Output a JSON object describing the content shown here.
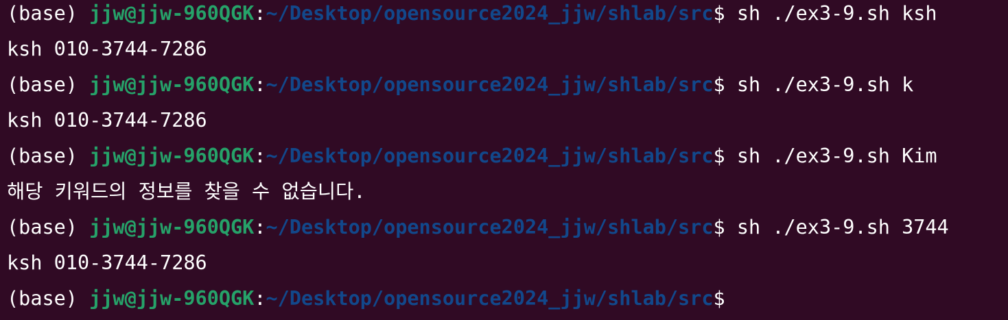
{
  "terminal": {
    "colors": {
      "background": "#300a24",
      "text": "#ffffff",
      "user_host": "#26a269",
      "path": "#12488b"
    },
    "lines": [
      {
        "type": "prompt",
        "env": "(base) ",
        "user_host": "jjw@jjw-960QGK",
        "colon": ":",
        "path": "~/Desktop/opensource2024_jjw/shlab/src",
        "symbol": "$ ",
        "command": "sh ./ex3-9.sh ksh"
      },
      {
        "type": "output",
        "text": "ksh 010-3744-7286"
      },
      {
        "type": "prompt",
        "env": "(base) ",
        "user_host": "jjw@jjw-960QGK",
        "colon": ":",
        "path": "~/Desktop/opensource2024_jjw/shlab/src",
        "symbol": "$ ",
        "command": "sh ./ex3-9.sh k"
      },
      {
        "type": "output",
        "text": "ksh 010-3744-7286"
      },
      {
        "type": "prompt",
        "env": "(base) ",
        "user_host": "jjw@jjw-960QGK",
        "colon": ":",
        "path": "~/Desktop/opensource2024_jjw/shlab/src",
        "symbol": "$ ",
        "command": "sh ./ex3-9.sh Kim"
      },
      {
        "type": "output",
        "text": "해당 키워드의 정보를 찾을 수 없습니다."
      },
      {
        "type": "prompt",
        "env": "(base) ",
        "user_host": "jjw@jjw-960QGK",
        "colon": ":",
        "path": "~/Desktop/opensource2024_jjw/shlab/src",
        "symbol": "$ ",
        "command": "sh ./ex3-9.sh 3744"
      },
      {
        "type": "output",
        "text": "ksh 010-3744-7286"
      },
      {
        "type": "prompt",
        "env": "(base) ",
        "user_host": "jjw@jjw-960QGK",
        "colon": ":",
        "path": "~/Desktop/opensource2024_jjw/shlab/src",
        "symbol": "$",
        "command": ""
      }
    ]
  }
}
